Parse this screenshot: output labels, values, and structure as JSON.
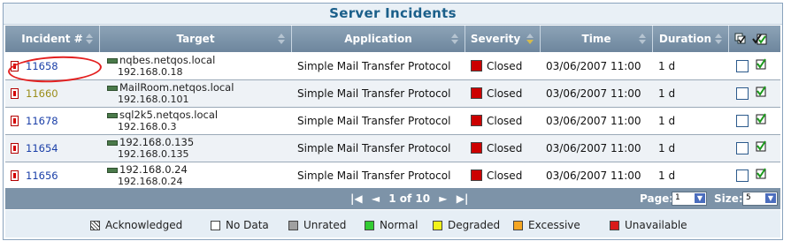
{
  "title": "Server Incidents",
  "columns": {
    "incident": "Incident #",
    "target": "Target",
    "application": "Application",
    "severity": "Severity",
    "time": "Time",
    "duration": "Duration"
  },
  "rows": [
    {
      "incident": "11658",
      "acknowledged": false,
      "target_name": "nqbes.netqos.local",
      "target_ip": "192.168.0.18",
      "application": "Simple Mail Transfer Protocol",
      "severity": "Closed",
      "time": "03/06/2007 11:00",
      "duration": "1 d"
    },
    {
      "incident": "11660",
      "acknowledged": true,
      "target_name": "MailRoom.netqos.local",
      "target_ip": "192.168.0.101",
      "application": "Simple Mail Transfer Protocol",
      "severity": "Closed",
      "time": "03/06/2007 11:00",
      "duration": "1 d"
    },
    {
      "incident": "11678",
      "acknowledged": false,
      "target_name": "sql2k5.netqos.local",
      "target_ip": "192.168.0.3",
      "application": "Simple Mail Transfer Protocol",
      "severity": "Closed",
      "time": "03/06/2007 11:00",
      "duration": "1 d"
    },
    {
      "incident": "11654",
      "acknowledged": false,
      "target_name": "192.168.0.135",
      "target_ip": "192.168.0.135",
      "application": "Simple Mail Transfer Protocol",
      "severity": "Closed",
      "time": "03/06/2007 11:00",
      "duration": "1 d"
    },
    {
      "incident": "11656",
      "acknowledged": false,
      "target_name": "192.168.0.24",
      "target_ip": "192.168.0.24",
      "application": "Simple Mail Transfer Protocol",
      "severity": "Closed",
      "time": "03/06/2007 11:00",
      "duration": "1 d"
    }
  ],
  "pager": {
    "page_text": "1 of 10",
    "page_label": "Page:",
    "page_value": "1",
    "size_label": "Size:",
    "size_value": "5"
  },
  "legend": [
    {
      "label": "Acknowledged",
      "color": "hatch"
    },
    {
      "label": "No Data",
      "color": "#ffffff"
    },
    {
      "label": "Unrated",
      "color": "#a0a0a0"
    },
    {
      "label": "Normal",
      "color": "#33cc33"
    },
    {
      "label": "Degraded",
      "color": "#f2f21a"
    },
    {
      "label": "Excessive",
      "color": "#f5a623"
    },
    {
      "label": "Unavailable",
      "color": "#d91a1a"
    }
  ],
  "colors": {
    "closed": "#cc0000",
    "header": "#7d93a8",
    "title": "#1b5f8a",
    "highlight_circle": "#e32020"
  }
}
